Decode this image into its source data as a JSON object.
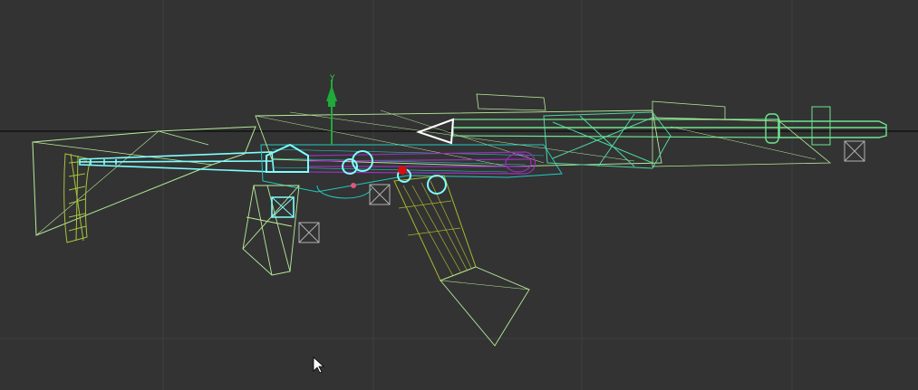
{
  "viewport": {
    "name": "wireframe-viewport",
    "background": "#333333",
    "grid_color": "#3f3f3f",
    "horizon_color": "#0b0b0b"
  },
  "model": {
    "name": "assault-rifle-wireframe",
    "colors": {
      "frame": "#b8ec9a",
      "frame_bright": "#8ef0a6",
      "barrel": "#6ee68e",
      "handguard": "#4fd6a0",
      "stock": "#a7c43a",
      "magazine": "#a9b62c",
      "receiver": "#22c8c0",
      "selection": "#7fffff",
      "rail": "#9b2fbf",
      "accent_red": "#d01010",
      "dummy_helper": "#b0b0b0"
    },
    "helpers": [
      "dummy-helper-icon",
      "dummy-helper-icon",
      "dummy-helper-icon"
    ]
  },
  "gizmo": {
    "axis_label": "Y",
    "color": "#1faa3a"
  },
  "cursor": {
    "icon": "arrow-cursor-icon"
  }
}
